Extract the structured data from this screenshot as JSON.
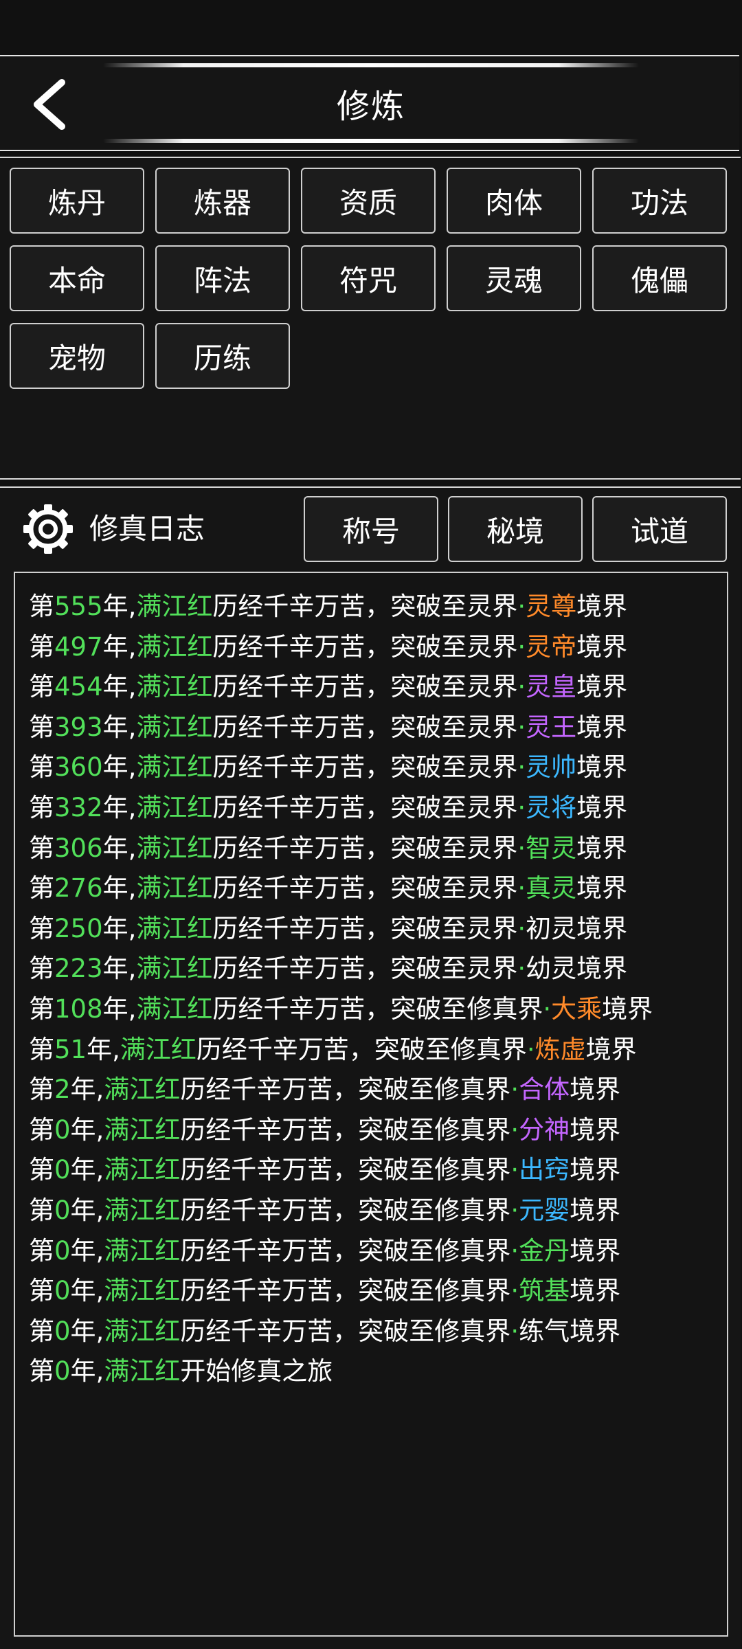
{
  "header": {
    "title": "修炼"
  },
  "tabs": [
    "炼丹",
    "炼器",
    "资质",
    "肉体",
    "功法",
    "本命",
    "阵法",
    "符咒",
    "灵魂",
    "傀儡",
    "宠物",
    "历练"
  ],
  "log_panel": {
    "title": "修真日志",
    "buttons": [
      "称号",
      "秘境",
      "试道"
    ]
  },
  "log_entries": [
    {
      "prefix": "第",
      "year": "555",
      "mid": "年,",
      "name": "满江红",
      "text": "历经千辛万苦，突破至灵界",
      "dot": "·",
      "realm": "灵尊",
      "realm_color": "orange",
      "suffix": "境界"
    },
    {
      "prefix": "第",
      "year": "497",
      "mid": "年,",
      "name": "满江红",
      "text": "历经千辛万苦，突破至灵界",
      "dot": "·",
      "realm": "灵帝",
      "realm_color": "orange",
      "suffix": "境界"
    },
    {
      "prefix": "第",
      "year": "454",
      "mid": "年,",
      "name": "满江红",
      "text": "历经千辛万苦，突破至灵界",
      "dot": "·",
      "realm": "灵皇",
      "realm_color": "purple",
      "suffix": "境界"
    },
    {
      "prefix": "第",
      "year": "393",
      "mid": "年,",
      "name": "满江红",
      "text": "历经千辛万苦，突破至灵界",
      "dot": "·",
      "realm": "灵王",
      "realm_color": "purple",
      "suffix": "境界"
    },
    {
      "prefix": "第",
      "year": "360",
      "mid": "年,",
      "name": "满江红",
      "text": "历经千辛万苦，突破至灵界",
      "dot": "·",
      "realm": "灵帅",
      "realm_color": "cyan",
      "suffix": "境界"
    },
    {
      "prefix": "第",
      "year": "332",
      "mid": "年,",
      "name": "满江红",
      "text": "历经千辛万苦，突破至灵界",
      "dot": "·",
      "realm": "灵将",
      "realm_color": "cyan",
      "suffix": "境界"
    },
    {
      "prefix": "第",
      "year": "306",
      "mid": "年,",
      "name": "满江红",
      "text": "历经千辛万苦，突破至灵界",
      "dot": "·",
      "realm": "智灵",
      "realm_color": "green",
      "suffix": "境界"
    },
    {
      "prefix": "第",
      "year": "276",
      "mid": "年,",
      "name": "满江红",
      "text": "历经千辛万苦，突破至灵界",
      "dot": "·",
      "realm": "真灵",
      "realm_color": "green",
      "suffix": "境界"
    },
    {
      "prefix": "第",
      "year": "250",
      "mid": "年,",
      "name": "满江红",
      "text": "历经千辛万苦，突破至灵界",
      "dot": "·",
      "realm": "初灵",
      "realm_color": "white",
      "suffix": "境界"
    },
    {
      "prefix": "第",
      "year": "223",
      "mid": "年,",
      "name": "满江红",
      "text": "历经千辛万苦，突破至灵界",
      "dot": "·",
      "realm": "幼灵",
      "realm_color": "white",
      "suffix": "境界"
    },
    {
      "prefix": "第",
      "year": "108",
      "mid": "年,",
      "name": "满江红",
      "text": "历经千辛万苦，突破至修真界",
      "dot": "·",
      "realm": "大乘",
      "realm_color": "orange",
      "suffix": "境界"
    },
    {
      "prefix": "第",
      "year": "51",
      "mid": "年,",
      "name": "满江红",
      "text": "历经千辛万苦，突破至修真界",
      "dot": "·",
      "realm": "炼虚",
      "realm_color": "orange",
      "suffix": "境界"
    },
    {
      "prefix": "第",
      "year": "2",
      "mid": "年,",
      "name": "满江红",
      "text": "历经千辛万苦，突破至修真界",
      "dot": "·",
      "realm": "合体",
      "realm_color": "purple",
      "suffix": "境界"
    },
    {
      "prefix": "第",
      "year": "0",
      "mid": "年,",
      "name": "满江红",
      "text": "历经千辛万苦，突破至修真界",
      "dot": "·",
      "realm": "分神",
      "realm_color": "purple",
      "suffix": "境界"
    },
    {
      "prefix": "第",
      "year": "0",
      "mid": "年,",
      "name": "满江红",
      "text": "历经千辛万苦，突破至修真界",
      "dot": "·",
      "realm": "出窍",
      "realm_color": "cyan",
      "suffix": "境界"
    },
    {
      "prefix": "第",
      "year": "0",
      "mid": "年,",
      "name": "满江红",
      "text": "历经千辛万苦，突破至修真界",
      "dot": "·",
      "realm": "元婴",
      "realm_color": "cyan",
      "suffix": "境界"
    },
    {
      "prefix": "第",
      "year": "0",
      "mid": "年,",
      "name": "满江红",
      "text": "历经千辛万苦，突破至修真界",
      "dot": "·",
      "realm": "金丹",
      "realm_color": "green",
      "suffix": "境界"
    },
    {
      "prefix": "第",
      "year": "0",
      "mid": "年,",
      "name": "满江红",
      "text": "历经千辛万苦，突破至修真界",
      "dot": "·",
      "realm": "筑基",
      "realm_color": "green",
      "suffix": "境界"
    },
    {
      "prefix": "第",
      "year": "0",
      "mid": "年,",
      "name": "满江红",
      "text": "历经千辛万苦，突破至修真界",
      "dot": "·",
      "realm": "练气",
      "realm_color": "white",
      "suffix": "境界"
    },
    {
      "prefix": "第",
      "year": "0",
      "mid": "年,",
      "name": "满江红",
      "text": "开始修真之旅",
      "dot": "",
      "realm": "",
      "realm_color": "white",
      "suffix": ""
    }
  ],
  "colors": {
    "background": "#111111",
    "name_green": "#52e05a",
    "realm_orange": "#ff8a2a",
    "realm_purple": "#c466ff",
    "realm_cyan": "#3cb8ff"
  }
}
